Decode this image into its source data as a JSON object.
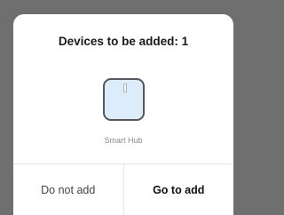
{
  "dialog": {
    "title": "Devices to be added: 1",
    "device": {
      "icon": "smart-hub-icon",
      "name": "Smart Hub"
    },
    "buttons": {
      "cancel_label": "Do not add",
      "confirm_label": "Go to add"
    }
  },
  "colors": {
    "backdrop": "#6f6f6f",
    "dialog_background": "#ffffff",
    "device_icon_fill": "#dcecfa",
    "device_icon_stroke": "#55575c",
    "divider": "#e3e3e3"
  }
}
